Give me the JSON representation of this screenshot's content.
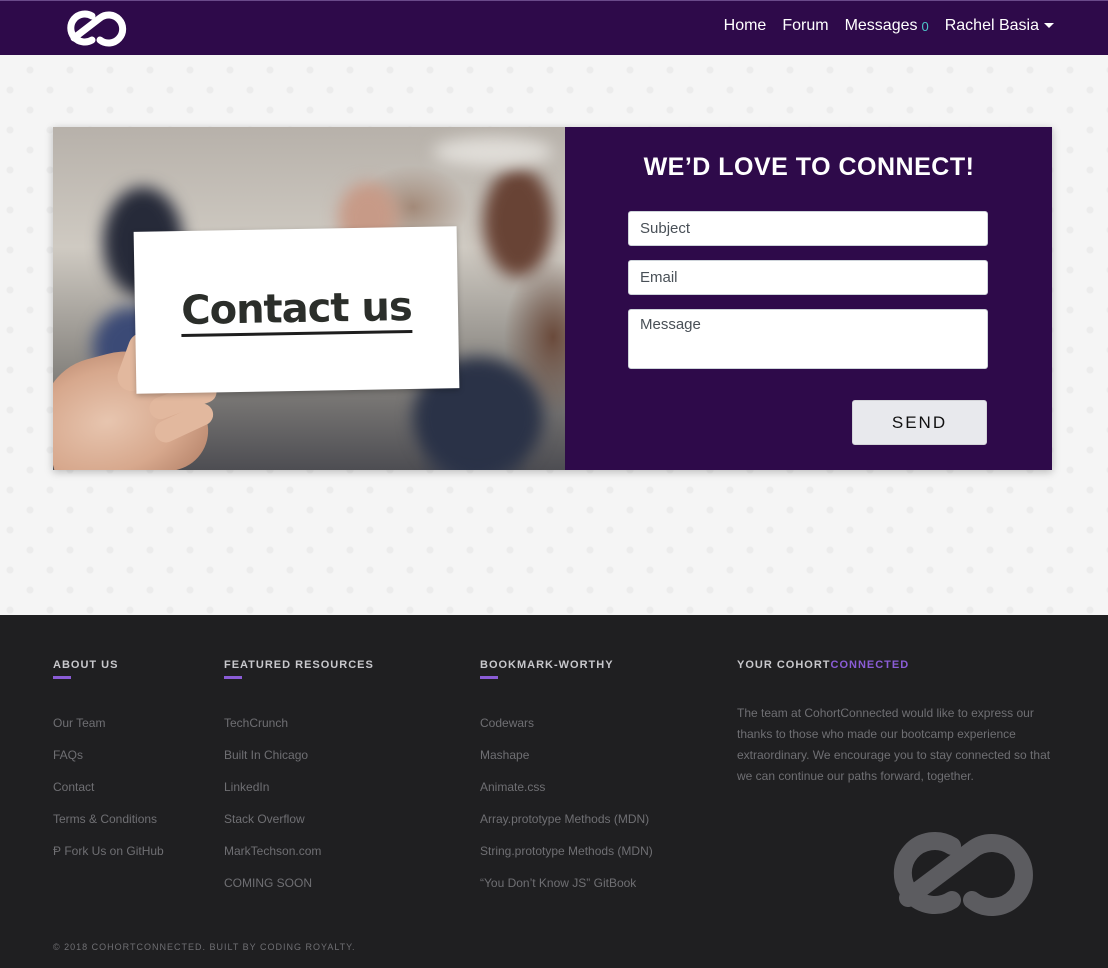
{
  "nav": {
    "logo": "cc-logo-icon",
    "links": [
      "Home",
      "Forum",
      "Messages",
      "Rachel Basia"
    ],
    "message_count": "0",
    "colors": {
      "bg": "#2e0a4a",
      "count": "#4ec6c9"
    }
  },
  "hero": {
    "image_caption": "Contact us"
  },
  "form": {
    "title": "WE’D LOVE TO CONNECT!",
    "subject_placeholder": "Subject",
    "email_placeholder": "Email",
    "message_placeholder": "Message",
    "send_label": "SEND"
  },
  "footer": {
    "about": {
      "heading": "ABOUT US",
      "links": [
        "Our Team",
        "FAQs",
        "Contact",
        "Terms & Conditions",
        "Ᵽ Fork Us on GitHub"
      ]
    },
    "resources": {
      "heading": "FEATURED RESOURCES",
      "links": [
        "TechCrunch",
        "Built In Chicago",
        "LinkedIn",
        "Stack Overflow",
        "MarkTechson.com",
        "COMING SOON"
      ]
    },
    "bookmarks": {
      "heading": "BOOKMARK-WORTHY",
      "links": [
        "Codewars",
        "Mashape",
        "Animate.css",
        "Array.prototype Methods (MDN)",
        "String.prototype Methods (MDN)",
        "“You Don’t Know JS” GitBook"
      ]
    },
    "cohort": {
      "heading_prefix": "YOUR COHORT",
      "heading_accent": "CONNECTED",
      "text": "The team at CohortConnected would like to express our thanks to those who made our bootcamp experience extraordinary. We encourage you to stay connected so that we can continue our paths forward, together."
    },
    "copyright": "© 2018 COHORTCONNECTED. BUILT BY CODING ROYALTY.",
    "colors": {
      "bg": "#1f1f21",
      "accent": "#8a5cd6"
    }
  }
}
